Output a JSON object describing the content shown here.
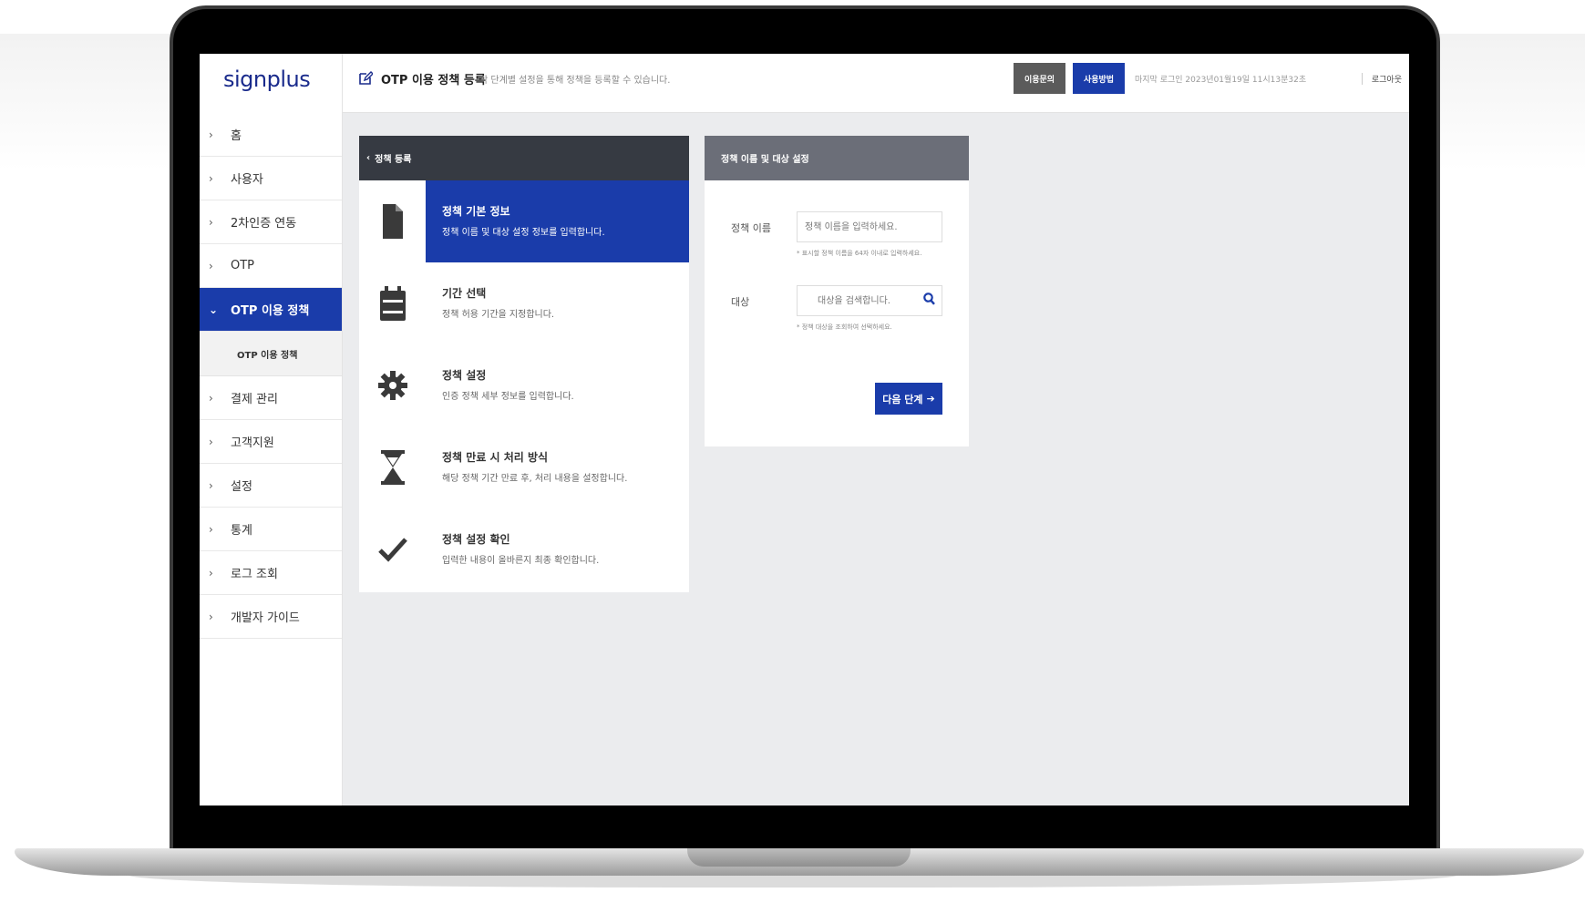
{
  "header": {
    "logo": "signplus",
    "page_title": "OTP 이용 정책 등록",
    "page_desc": "각 단계별 설정을 통해 정책을 등록할 수 있습니다.",
    "inquiry_label": "이용문의",
    "guide_label": "사용방법",
    "last_login": "마지막 로그인 2023년01월19일 11시13분32초",
    "logout_label": "로그아웃"
  },
  "sidebar": {
    "items": [
      {
        "label": "홈"
      },
      {
        "label": "사용자"
      },
      {
        "label": "2차인증 연동"
      },
      {
        "label": "OTP"
      },
      {
        "label": "OTP 이용 정책",
        "active": true
      },
      {
        "label": "결제 관리"
      },
      {
        "label": "고객지원"
      },
      {
        "label": "설정"
      },
      {
        "label": "통계"
      },
      {
        "label": "로그 조회"
      },
      {
        "label": "개발자 가이드"
      }
    ],
    "sub_item": "OTP 이용 정책"
  },
  "steps_panel": {
    "back_label": "정책 등록",
    "steps": [
      {
        "icon": "document-icon",
        "title": "정책 기본 정보",
        "desc": "정책 이름 및 대상 설정 정보를 입력합니다.",
        "active": true
      },
      {
        "icon": "calendar-icon",
        "title": "기간 선택",
        "desc": "정책 허용 기간을 지정합니다."
      },
      {
        "icon": "gear-icon",
        "title": "정책 설정",
        "desc": "인증 정책 세부 정보를 입력합니다."
      },
      {
        "icon": "hourglass-icon",
        "title": "정책 만료 시 처리 방식",
        "desc": "해당 정책 기간 만료 후, 처리 내용을 설정합니다."
      },
      {
        "icon": "check-icon",
        "title": "정책 설정 확인",
        "desc": "입력한 내용이 올바른지 최종 확인합니다."
      }
    ]
  },
  "form": {
    "title": "정책 이름 및 대상 설정",
    "name_label": "정책 이름",
    "name_placeholder": "정책 이름을 입력하세요.",
    "name_hint": "* 표시할 정책 이름을 64자 이내로 입력하세요.",
    "target_label": "대상",
    "target_placeholder": "대상을 검색합니다.",
    "target_hint": "* 정책 대상을 조회하여 선택하세요.",
    "next_label": "다음 단계"
  },
  "colors": {
    "brand": "#1a3caa",
    "dark_header": "#363a42",
    "form_header": "#6b6e78"
  }
}
